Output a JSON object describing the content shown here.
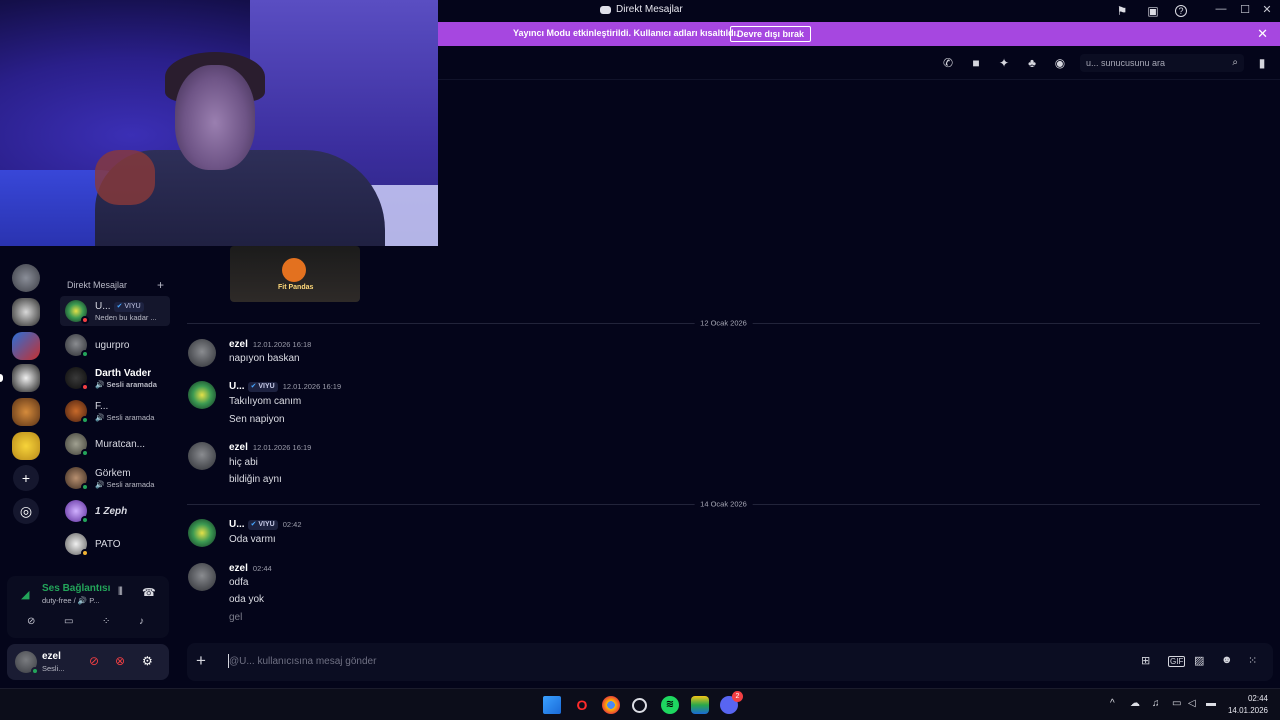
{
  "window": {
    "title": "Direkt Mesajlar",
    "minimize": "—",
    "maximize": "☐",
    "close": "✕"
  },
  "banner": {
    "message": "Yayıncı Modu etkinleştirildi. Kullanıcı adları kısaltıldı.",
    "button": "Devre dışı bırak",
    "close": "✕"
  },
  "header": {
    "search_placeholder": "u... sunucusunu ara"
  },
  "sidebar": {
    "dm_header": "Direkt Mesajlar",
    "dm_add": "+",
    "dms": [
      {
        "name": "U...",
        "tag": "VIYU",
        "status_text": "Neden bu kadar ...",
        "status": "dnd",
        "active": true
      },
      {
        "name": "ugurpro",
        "status": "online"
      },
      {
        "name": "Darth Vader",
        "status_text": "Sesli aramada",
        "status": "dnd"
      },
      {
        "name": "F...",
        "status_text": "Sesli aramada",
        "status": "online"
      },
      {
        "name": "Muratcan...",
        "status": "online"
      },
      {
        "name": "Görkem",
        "status_text": "Sesli aramada",
        "status": "online"
      },
      {
        "name": "1 Zeph",
        "status": "online"
      },
      {
        "name": "PATO",
        "status": "idle"
      }
    ]
  },
  "voice": {
    "title": "Ses Bağlantısı",
    "detail": "duty-free / 🔊 P..."
  },
  "user": {
    "name": "ezel",
    "status": "Sesli..."
  },
  "chat": {
    "dividers": [
      "12 Ocak 2026",
      "14 Ocak 2026"
    ],
    "messages": [
      {
        "author": "ezel",
        "time": "12.01.2026 16:18",
        "lines": [
          "napıyon baskan"
        ]
      },
      {
        "author": "U...",
        "tag": "VIYU",
        "time": "12.01.2026 16:19",
        "lines": [
          "Takılıyom canım",
          "Sen napiyon"
        ]
      },
      {
        "author": "ezel",
        "time": "12.01.2026 16:19",
        "lines": [
          "hiç abi",
          "bildiğin aynı"
        ]
      },
      {
        "author": "U...",
        "tag": "VIYU",
        "time": "02:42",
        "lines": [
          "Oda varmı"
        ]
      },
      {
        "author": "ezel",
        "time": "02:44",
        "lines": [
          "odfa",
          "oda yok",
          "gel"
        ]
      }
    ],
    "attachment_caption": "Fit Pandas"
  },
  "composer": {
    "placeholder": "@U... kullanıcısına mesaj gönder"
  },
  "taskbar": {
    "time": "02:44",
    "date": "14.01.2026",
    "discord_badge": "2"
  },
  "colors": {
    "banner": "#a647e0",
    "background": "#04051a",
    "online": "#23a55a",
    "dnd": "#f23f43"
  }
}
